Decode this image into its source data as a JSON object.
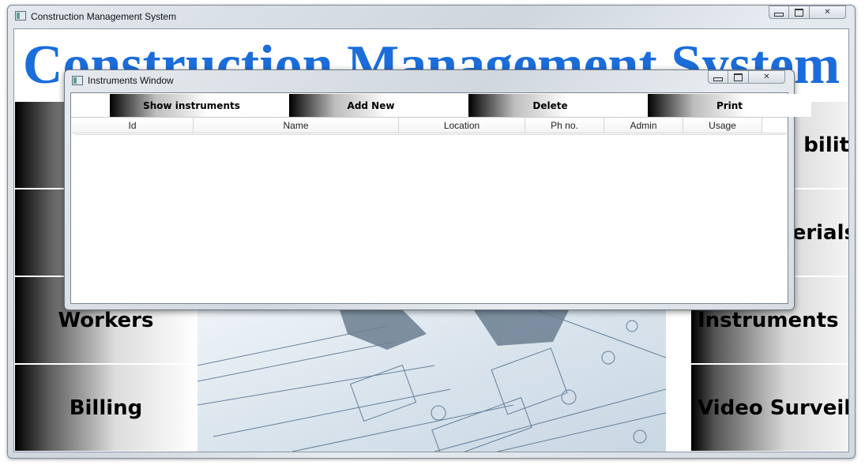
{
  "main_window": {
    "title": "Construction Management System",
    "heading": "Construction Management System",
    "tiles_left": [
      "",
      "",
      "Workers",
      "Billing"
    ],
    "tiles_right": [
      "biliti",
      "erials",
      "Instruments",
      "Video Surveila"
    ]
  },
  "dialog": {
    "title": "Instruments Window",
    "buttons": [
      "Show instruments",
      "Add New",
      "Delete",
      "Print"
    ],
    "columns": [
      "Id",
      "Name",
      "Location",
      "Ph no.",
      "Admin",
      "Usage"
    ]
  },
  "colors": {
    "heading": "#1b6ddb"
  }
}
